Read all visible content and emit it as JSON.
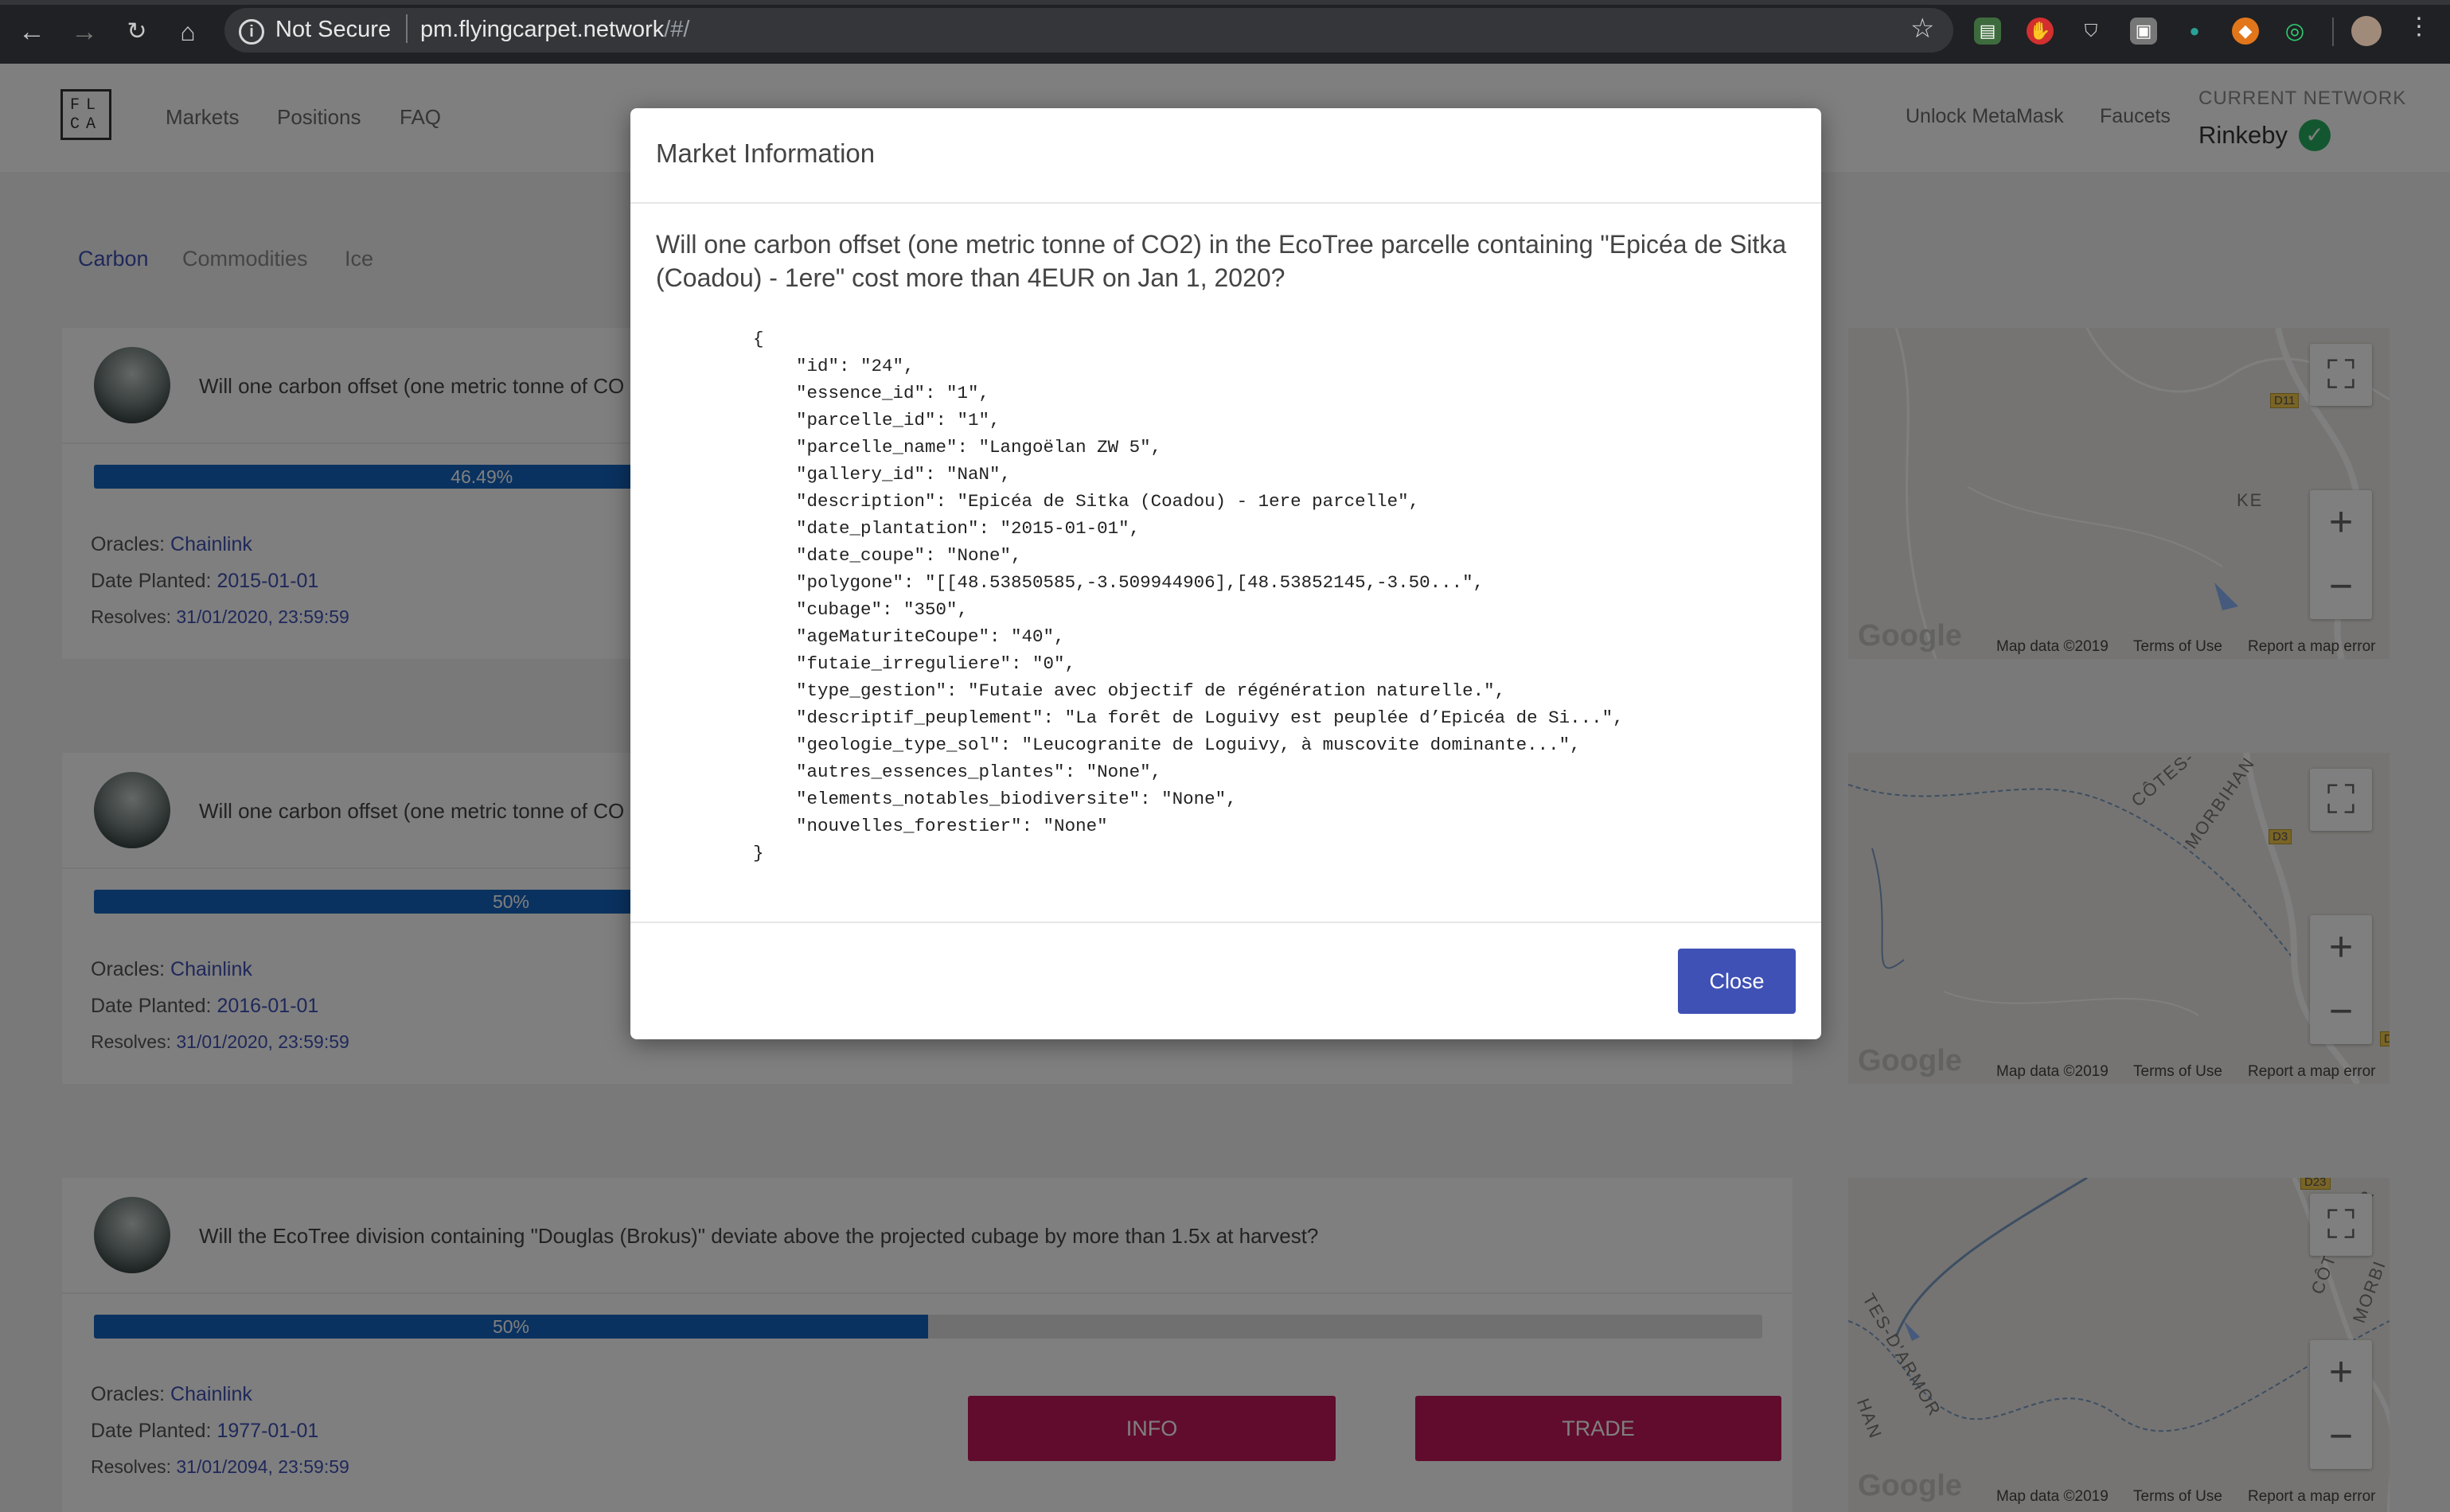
{
  "browser": {
    "security_text": "Not Secure",
    "url_host": "pm.flyingcarpet.network",
    "url_path": "/#/"
  },
  "app": {
    "logo_text": "FLCA",
    "nav": [
      "Markets",
      "Positions",
      "FAQ"
    ],
    "nav_right": [
      "Unlock MetaMask",
      "Faucets"
    ],
    "network_label": "CURRENT NETWORK",
    "network_value": "Rinkeby",
    "filters": [
      "Carbon",
      "Commodities",
      "Ice"
    ],
    "active_filter": "Carbon"
  },
  "markets": [
    {
      "question": "Will one carbon offset (one metric tonne of CO2) in the EcoTree parcelle containing \"Epicéa de Sitka (Coadou) - 1ere\" cost more than 4EUR on Jan 1, 2020?",
      "question_visible": "Will one carbon offset (one metric tonne of CO",
      "progress_label": "46.49%",
      "progress": 0.4649,
      "oracles_label": "Oracles:",
      "oracle": "Chainlink",
      "planted_label": "Date Planted:",
      "planted": "2015-01-01",
      "resolves_label": "Resolves:",
      "resolves": "31/01/2020, 23:59:59"
    },
    {
      "question_visible": "Will one carbon offset (one metric tonne of CO",
      "progress_label": "50%",
      "progress": 0.5,
      "oracles_label": "Oracles:",
      "oracle": "Chainlink",
      "planted_label": "Date Planted:",
      "planted": "2016-01-01",
      "resolves_label": "Resolves:",
      "resolves": "31/01/2020, 23:59:59"
    },
    {
      "question_visible": "Will the EcoTree division containing \"Douglas (Brokus)\" deviate above the projected cubage by more than 1.5x at harvest?",
      "progress_label": "50%",
      "progress": 0.5,
      "oracles_label": "Oracles:",
      "oracle": "Chainlink",
      "planted_label": "Date Planted:",
      "planted": "1977-01-01",
      "resolves_label": "Resolves:",
      "resolves": "31/01/2094, 23:59:59",
      "info_label": "INFO",
      "trade_label": "TRADE"
    }
  ],
  "maps": {
    "attribution": "Map data ©2019",
    "terms": "Terms of Use",
    "report": "Report a map error",
    "google": "Google",
    "labels": {
      "road1": "D11",
      "road2": "D3",
      "road3": "D23",
      "place1": "KE",
      "place1b": "A",
      "place2": "CÔTES-",
      "place3": "MORBIHAN",
      "place4": "TES-D'ARMOR",
      "place5": "CÔTE",
      "place6": "MORBI",
      "place7": "HAN",
      "place8": "D",
      "place9": "OR"
    }
  },
  "modal": {
    "title": "Market Information",
    "question": "Will one carbon offset (one metric tonne of CO2) in the EcoTree parcelle containing \"Epicéa de Sitka (Coadou) - 1ere\" cost more than 4EUR on Jan 1, 2020?",
    "json_text": "{\n    \"id\": \"24\",\n    \"essence_id\": \"1\",\n    \"parcelle_id\": \"1\",\n    \"parcelle_name\": \"Langoëlan ZW 5\",\n    \"gallery_id\": \"NaN\",\n    \"description\": \"Epicéa de Sitka (Coadou) - 1ere parcelle\",\n    \"date_plantation\": \"2015-01-01\",\n    \"date_coupe\": \"None\",\n    \"polygone\": \"[[48.53850585,-3.509944906],[48.53852145,-3.50...\",\n    \"cubage\": \"350\",\n    \"ageMaturiteCoupe\": \"40\",\n    \"futaie_irreguliere\": \"0\",\n    \"type_gestion\": \"Futaie avec objectif de régénération naturelle.\",\n    \"descriptif_peuplement\": \"La forêt de Loguivy est peuplée d’Epicéa de Si...\",\n    \"geologie_type_sol\": \"Leucogranite de Loguivy, à muscovite dominante...\",\n    \"autres_essences_plantes\": \"None\",\n    \"elements_notables_biodiversite\": \"None\",\n    \"nouvelles_forestier\": \"None\"\n}",
    "close_label": "Close"
  }
}
